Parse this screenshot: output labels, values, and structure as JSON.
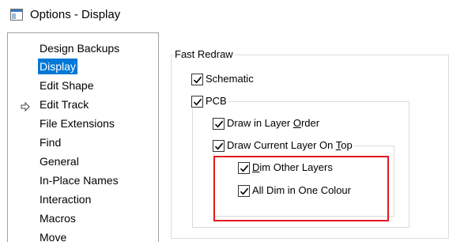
{
  "window": {
    "title": "Options - Display"
  },
  "nav": {
    "items": [
      {
        "label": "Design Backups"
      },
      {
        "label": "Display",
        "selected": true
      },
      {
        "label": "Edit Shape"
      },
      {
        "label": "Edit Track"
      },
      {
        "label": "File Extensions"
      },
      {
        "label": "Find"
      },
      {
        "label": "General"
      },
      {
        "label": "In-Place Names"
      },
      {
        "label": "Interaction"
      },
      {
        "label": "Macros"
      },
      {
        "label": "Move"
      }
    ]
  },
  "display": {
    "fast_redraw": {
      "label": "Fast Redraw",
      "schematic": {
        "label": "Schematic",
        "checked": true
      },
      "pcb": {
        "label": "PCB",
        "checked": true,
        "draw_in_layer_order": {
          "prefix": "Draw in Layer ",
          "accel": "O",
          "suffix": "rder",
          "checked": true
        },
        "draw_current_layer_on_top": {
          "prefix": "Draw Current Layer On ",
          "accel": "T",
          "suffix": "op",
          "checked": true,
          "dim_other_layers": {
            "prefix": "",
            "accel": "D",
            "suffix": "im Other Layers",
            "checked": true
          },
          "all_dim_in_one_colour": {
            "label": "All Dim in One Colour",
            "checked": true
          }
        }
      }
    }
  },
  "colors": {
    "selection": "#0078d7",
    "highlight_border": "#e3191e",
    "group_border": "#dcdcdc"
  }
}
